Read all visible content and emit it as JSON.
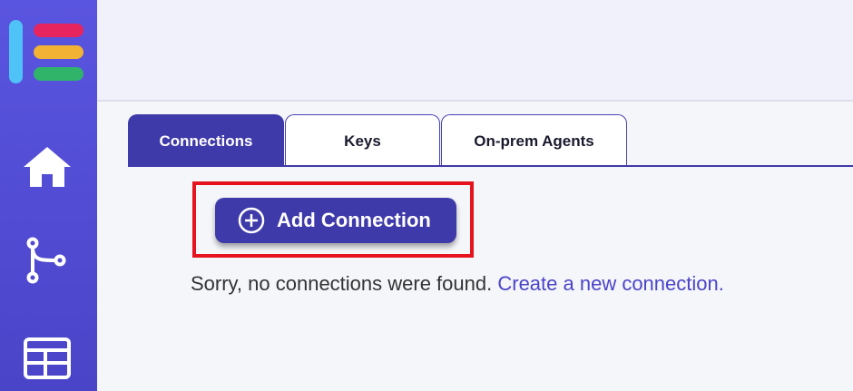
{
  "sidebar": {
    "logo": "app-logo",
    "items": [
      {
        "icon": "home-icon"
      },
      {
        "icon": "branch-icon"
      },
      {
        "icon": "table-icon"
      }
    ],
    "colors": {
      "background": "#4f4ad6"
    }
  },
  "tabs": [
    {
      "label": "Connections",
      "active": true
    },
    {
      "label": "Keys",
      "active": false
    },
    {
      "label": "On-prem Agents",
      "active": false
    }
  ],
  "main": {
    "add_button_label": "Add Connection",
    "add_button_icon": "plus-circle-icon",
    "empty_message": "Sorry, no connections were found.",
    "create_link": "Create a new connection."
  },
  "colors": {
    "accent": "#3f3aa9",
    "highlight": "#e5141f",
    "link": "#4a44c8"
  }
}
